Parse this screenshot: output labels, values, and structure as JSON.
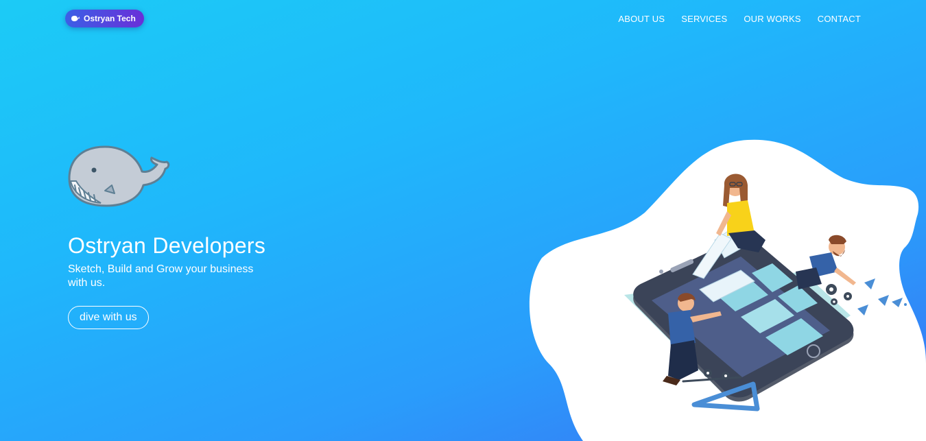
{
  "header": {
    "brand_label": "Ostryan Tech",
    "brand_icon": "whale-icon",
    "nav": [
      {
        "label": "ABOUT US"
      },
      {
        "label": "SERVICES"
      },
      {
        "label": "OUR WORKS"
      },
      {
        "label": "CONTACT"
      }
    ]
  },
  "hero": {
    "mascot_icon": "whale-mascot",
    "title": "Ostryan Developers",
    "subtitle": "Sketch, Build and Grow your business with us.",
    "cta_label": "dive with us",
    "illustration": "team-building-mobile-app-illustration"
  },
  "colors": {
    "gradient_start": "#1ccbf6",
    "gradient_end": "#3a72f4",
    "brand_pill_start": "#3b5fe6",
    "brand_pill_end": "#6a2fd8"
  }
}
